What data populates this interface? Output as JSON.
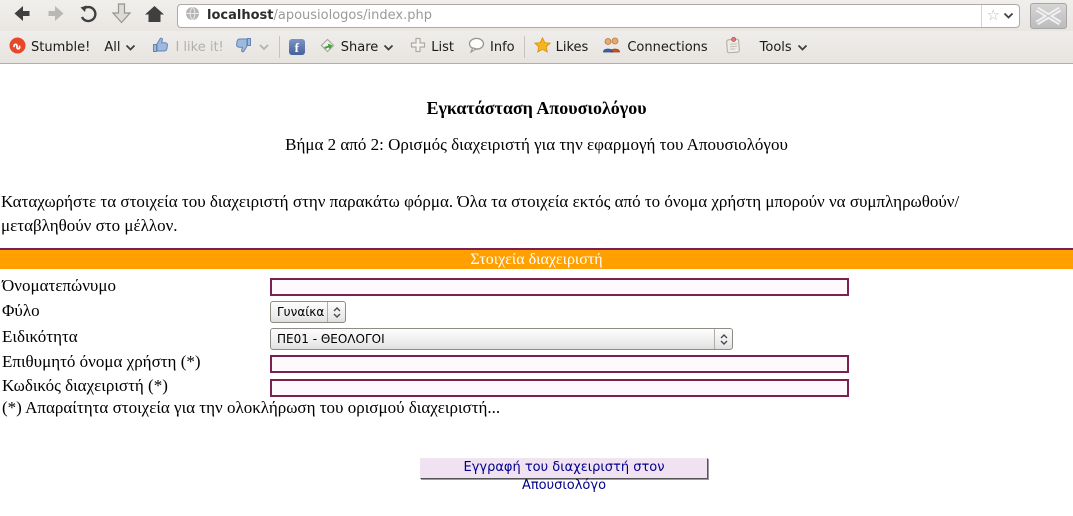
{
  "browser": {
    "url": {
      "host": "localhost",
      "path": "/apousiologos/index.php"
    }
  },
  "sutoolbar": {
    "stumble": "Stumble!",
    "all": "All",
    "like": "I like it!",
    "share": "Share",
    "list": "List",
    "info": "Info",
    "likes": "Likes",
    "connections": "Connections",
    "tools": "Tools"
  },
  "icons": {
    "url_star": "☆",
    "facebook_glyph": "f"
  },
  "page": {
    "title": "Εγκατάσταση Απουσιολόγου",
    "subtitle": "Βήμα 2 από 2: Ορισμός διαχειριστή για την εφαρμογή του Απουσιολόγου",
    "intro": "Καταχωρήστε τα στοιχεία του διαχειριστή στην παρακάτω φόρμα. Όλα τα στοιχεία εκτός από το όνομα χρήστη μπορούν να συμπληρωθούν/μεταβληθούν στο μέλλον.",
    "form": {
      "header": "Στοιχεία διαχειριστή",
      "fullname_label": "Όνοματεπώνυμο",
      "gender_label": "Φύλο",
      "gender_value": "Γυναίκα",
      "specialty_label": "Ειδικότητα",
      "specialty_value": "ΠΕ01 - ΘΕΟΛΟΓΟΙ",
      "username_label": "Επιθυμητό όνομα χρήστη (*)",
      "password_label": "Κωδικός διαχειριστή (*)",
      "footnote": "(*) Απαραίτητα στοιχεία για την ολοκλήρωση του ορισμού διαχειριστή...",
      "submit": "Εγγραφή του διαχειριστή στον Απουσιολόγο"
    }
  },
  "colors": {
    "header_orange": "#FFA000",
    "form_border_maroon": "#7A2053",
    "button_bg": "#F0E2F0",
    "button_text": "#00008B",
    "stumble_red": "#E8472A",
    "facebook_blue": "#44619D",
    "star_gold": "#F6B41D"
  }
}
